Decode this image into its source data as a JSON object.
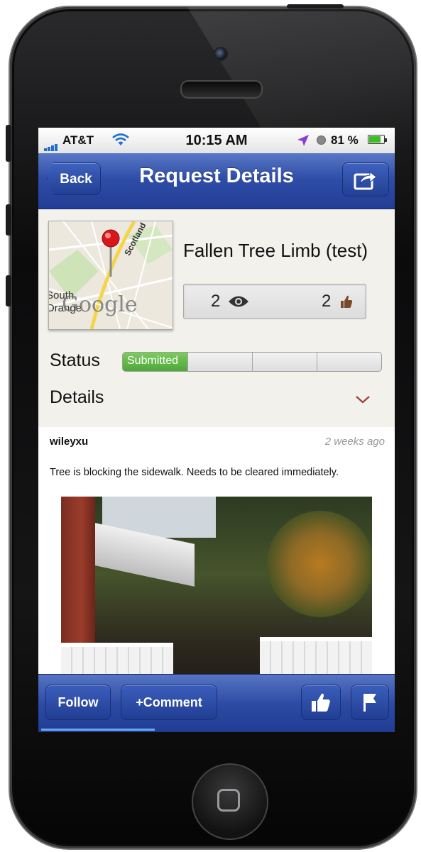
{
  "status_bar": {
    "carrier": "AT&T",
    "time": "10:15 AM",
    "battery": "81 %",
    "battery_level": 0.81,
    "icons": [
      "signal-icon",
      "wifi-icon",
      "location-icon",
      "alarm-icon",
      "battery-icon"
    ]
  },
  "nav": {
    "back_label": "Back",
    "title": "Request Details",
    "share_icon": "share-icon"
  },
  "request": {
    "title": "Fallen Tree Limb (test)",
    "views": "2",
    "likes": "2",
    "map": {
      "watermark": "Google",
      "label_south": "South",
      "label_orange": "Orange",
      "road_label": "Scotland"
    }
  },
  "status": {
    "label": "Status",
    "stage": "Submitted",
    "progress": 0.25,
    "segments": 4
  },
  "details": {
    "label": "Details"
  },
  "comment": {
    "author": "wileyxu",
    "time": "2 weeks ago",
    "text": "Tree is blocking the sidewalk. Needs to be cleared immediately."
  },
  "toolbar": {
    "follow_label": "Follow",
    "comment_label": "+Comment",
    "like_icon": "thumbs-up-icon",
    "flag_icon": "flag-icon"
  },
  "colors": {
    "nav_blue": "#2f4ea8",
    "status_green": "#4ea73a",
    "screen_bg": "#f3f1ec"
  }
}
